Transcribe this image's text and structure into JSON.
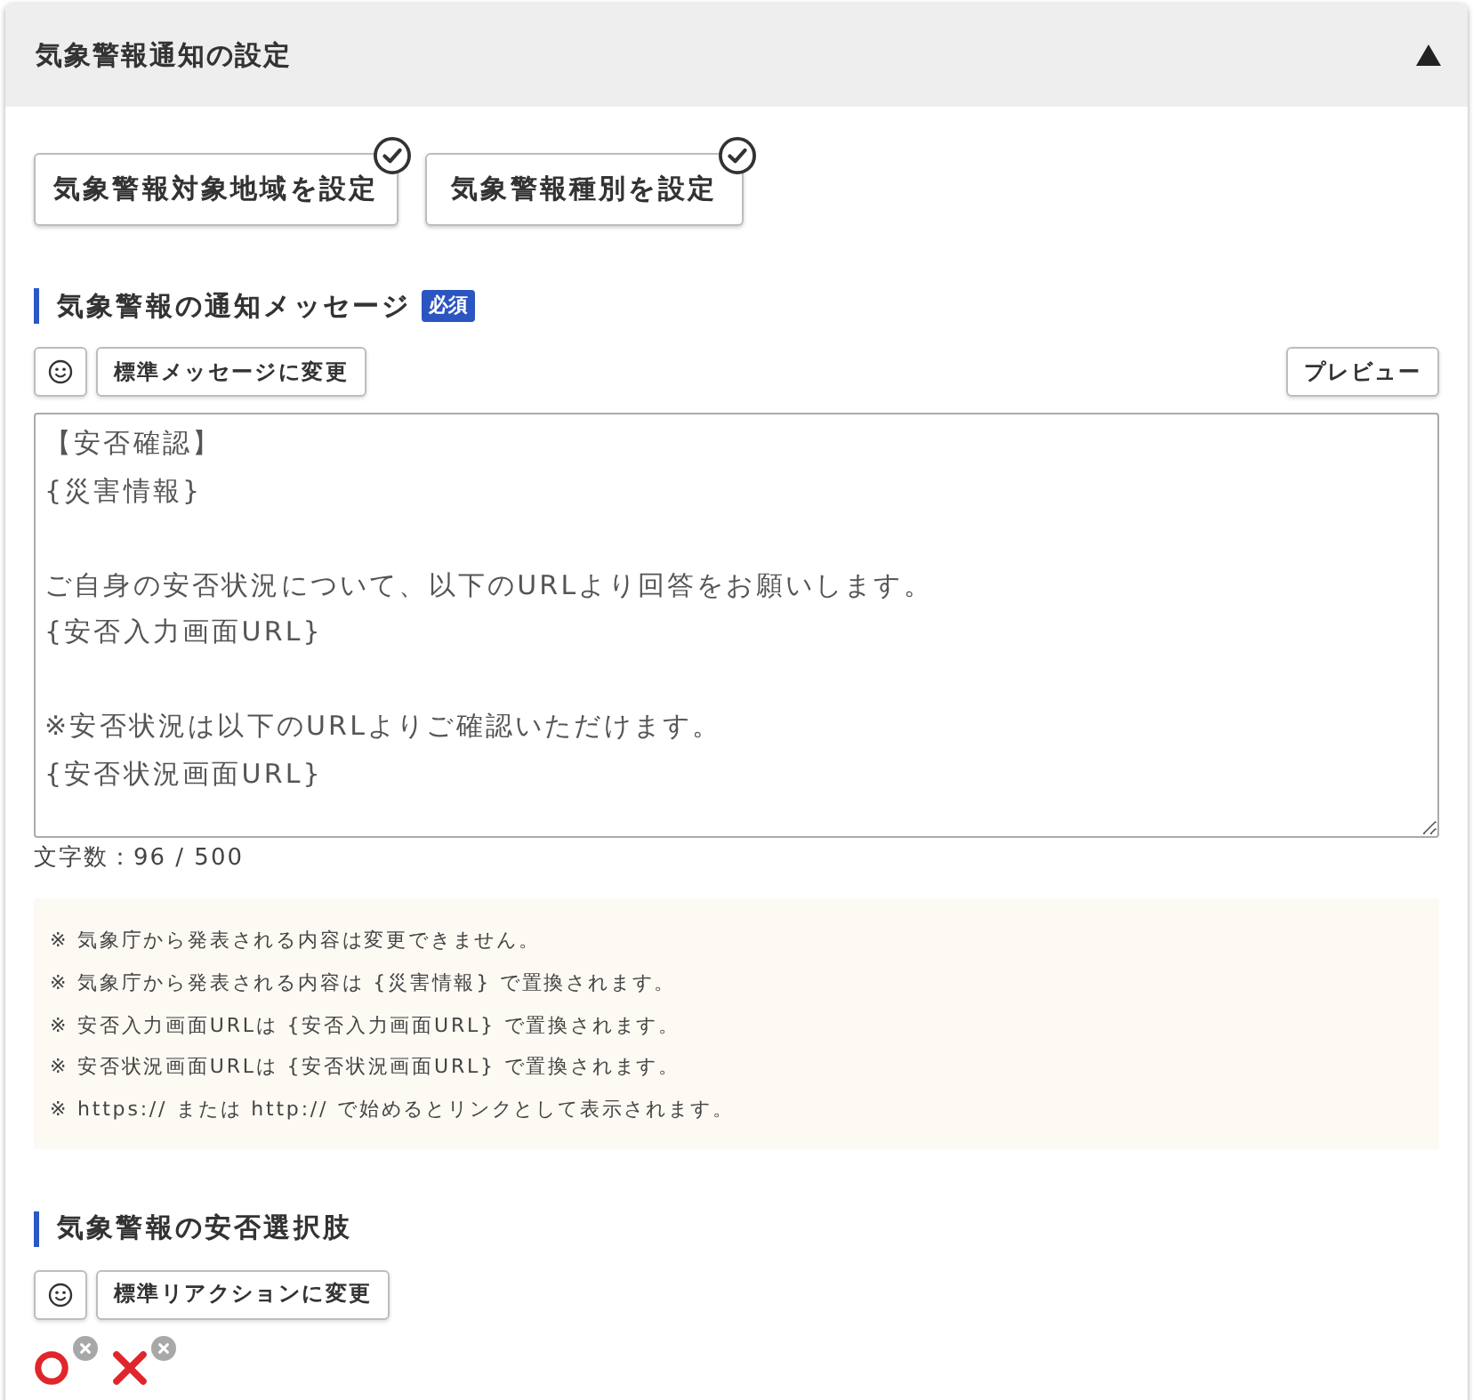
{
  "panel": {
    "title": "気象警報通知の設定",
    "expanded": true
  },
  "setting_buttons": [
    {
      "label": "気象警報対象地域を設定",
      "done": true
    },
    {
      "label": "気象警報種別を設定",
      "done": true
    }
  ],
  "message_section": {
    "heading": "気象警報の通知メッセージ",
    "badge": "必須",
    "reset_button": "標準メッセージに変更",
    "preview_button": "プレビュー",
    "message": "【安否確認】\n{災害情報}\n\nご自身の安否状況について、以下のURLより回答をお願いします。\n{安否入力画面URL}\n\n※安否状況は以下のURLよりご確認いただけます。\n{安否状況画面URL}",
    "char_count": "文字数：96 / 500",
    "notes": [
      "※ 気象庁から発表される内容は変更できません。",
      "※ 気象庁から発表される内容は {災害情報} で置換されます。",
      "※ 安否入力画面URLは {安否入力画面URL} で置換されます。",
      "※ 安否状況画面URLは {安否状況画面URL} で置換されます。",
      "※ https:// または http:// で始めるとリンクとして表示されます。"
    ]
  },
  "choice_section": {
    "heading": "気象警報の安否選択肢",
    "reset_button": "標準リアクションに変更",
    "reactions": [
      {
        "kind": "circle"
      },
      {
        "kind": "cross"
      }
    ]
  }
}
